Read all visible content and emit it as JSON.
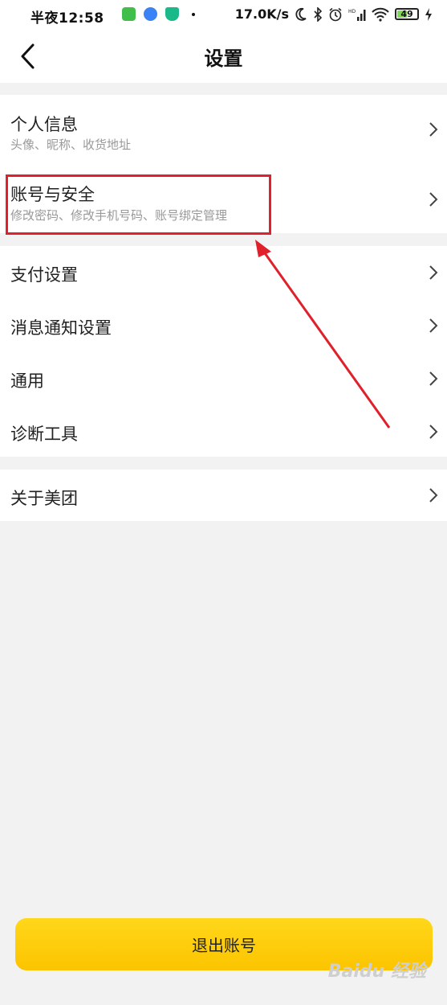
{
  "status_bar": {
    "time": "半夜12:58",
    "speed": "17.0K/s",
    "battery": "49"
  },
  "header": {
    "title": "设置"
  },
  "groups": [
    {
      "items": [
        {
          "title": "个人信息",
          "subtitle": "头像、昵称、收货地址"
        },
        {
          "title": "账号与安全",
          "subtitle": "修改密码、修改手机号码、账号绑定管理"
        }
      ]
    },
    {
      "items": [
        {
          "title": "支付设置"
        },
        {
          "title": "消息通知设置"
        },
        {
          "title": "通用"
        },
        {
          "title": "诊断工具"
        }
      ]
    },
    {
      "items": [
        {
          "title": "关于美团"
        }
      ]
    }
  ],
  "logout_label": "退出账号",
  "watermark": "Baidu 经验",
  "colors": {
    "accent": "#fcc400",
    "annotation": "#e0202a",
    "background": "#f2f2f2"
  }
}
